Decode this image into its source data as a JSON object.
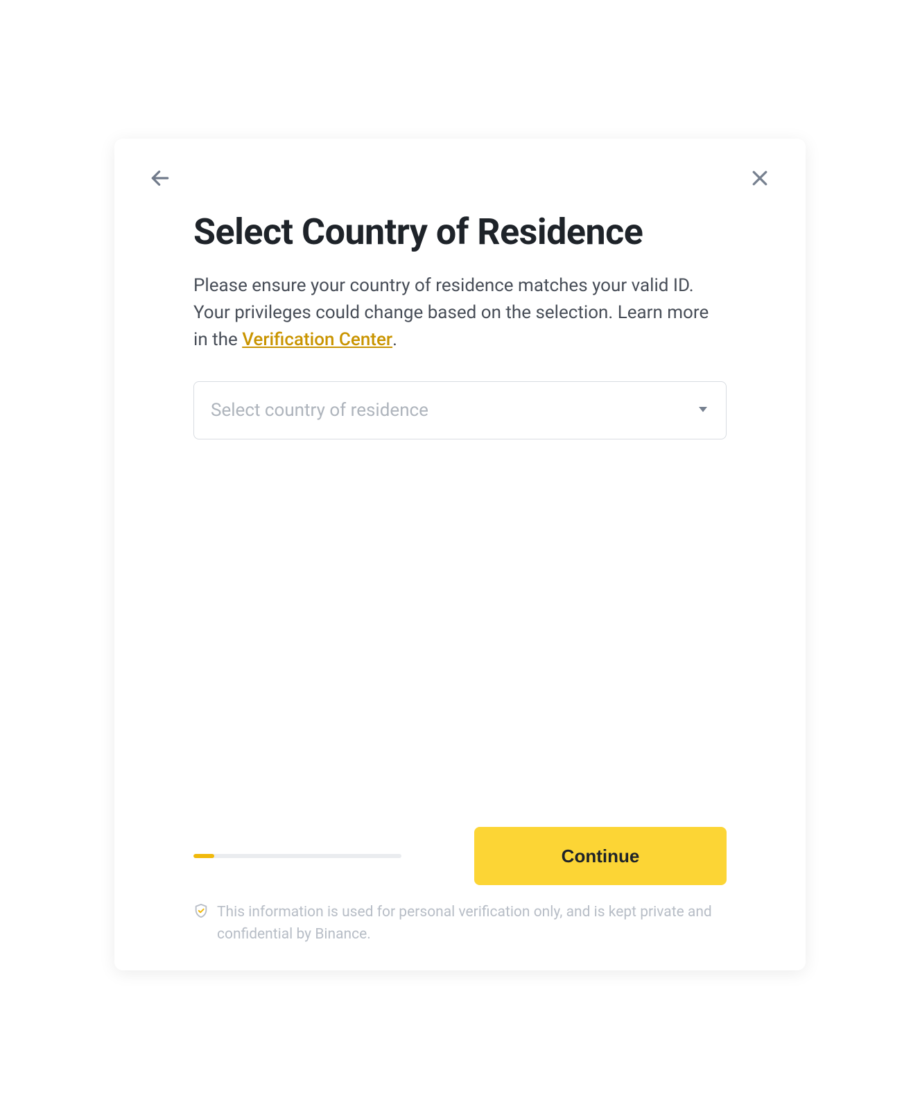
{
  "header": {
    "title": "Select Country of Residence"
  },
  "body": {
    "description_pre": "Please ensure your country of residence matches your valid ID. Your privileges could change based on the selection. Learn more in the ",
    "description_link": "Verification Center",
    "description_post": "."
  },
  "select": {
    "placeholder": "Select country of residence"
  },
  "actions": {
    "continue_label": "Continue"
  },
  "progress": {
    "percent": 10
  },
  "privacy": {
    "text": "This information is used for personal verification only, and is kept private and confidential by Binance."
  },
  "icons": {
    "back": "arrow-left-icon",
    "close": "close-icon",
    "caret": "caret-down-icon",
    "shield": "shield-check-icon"
  },
  "colors": {
    "accent": "#fcd535",
    "link": "#c99400",
    "text": "#1e2329",
    "muted": "#b7bdc6"
  }
}
